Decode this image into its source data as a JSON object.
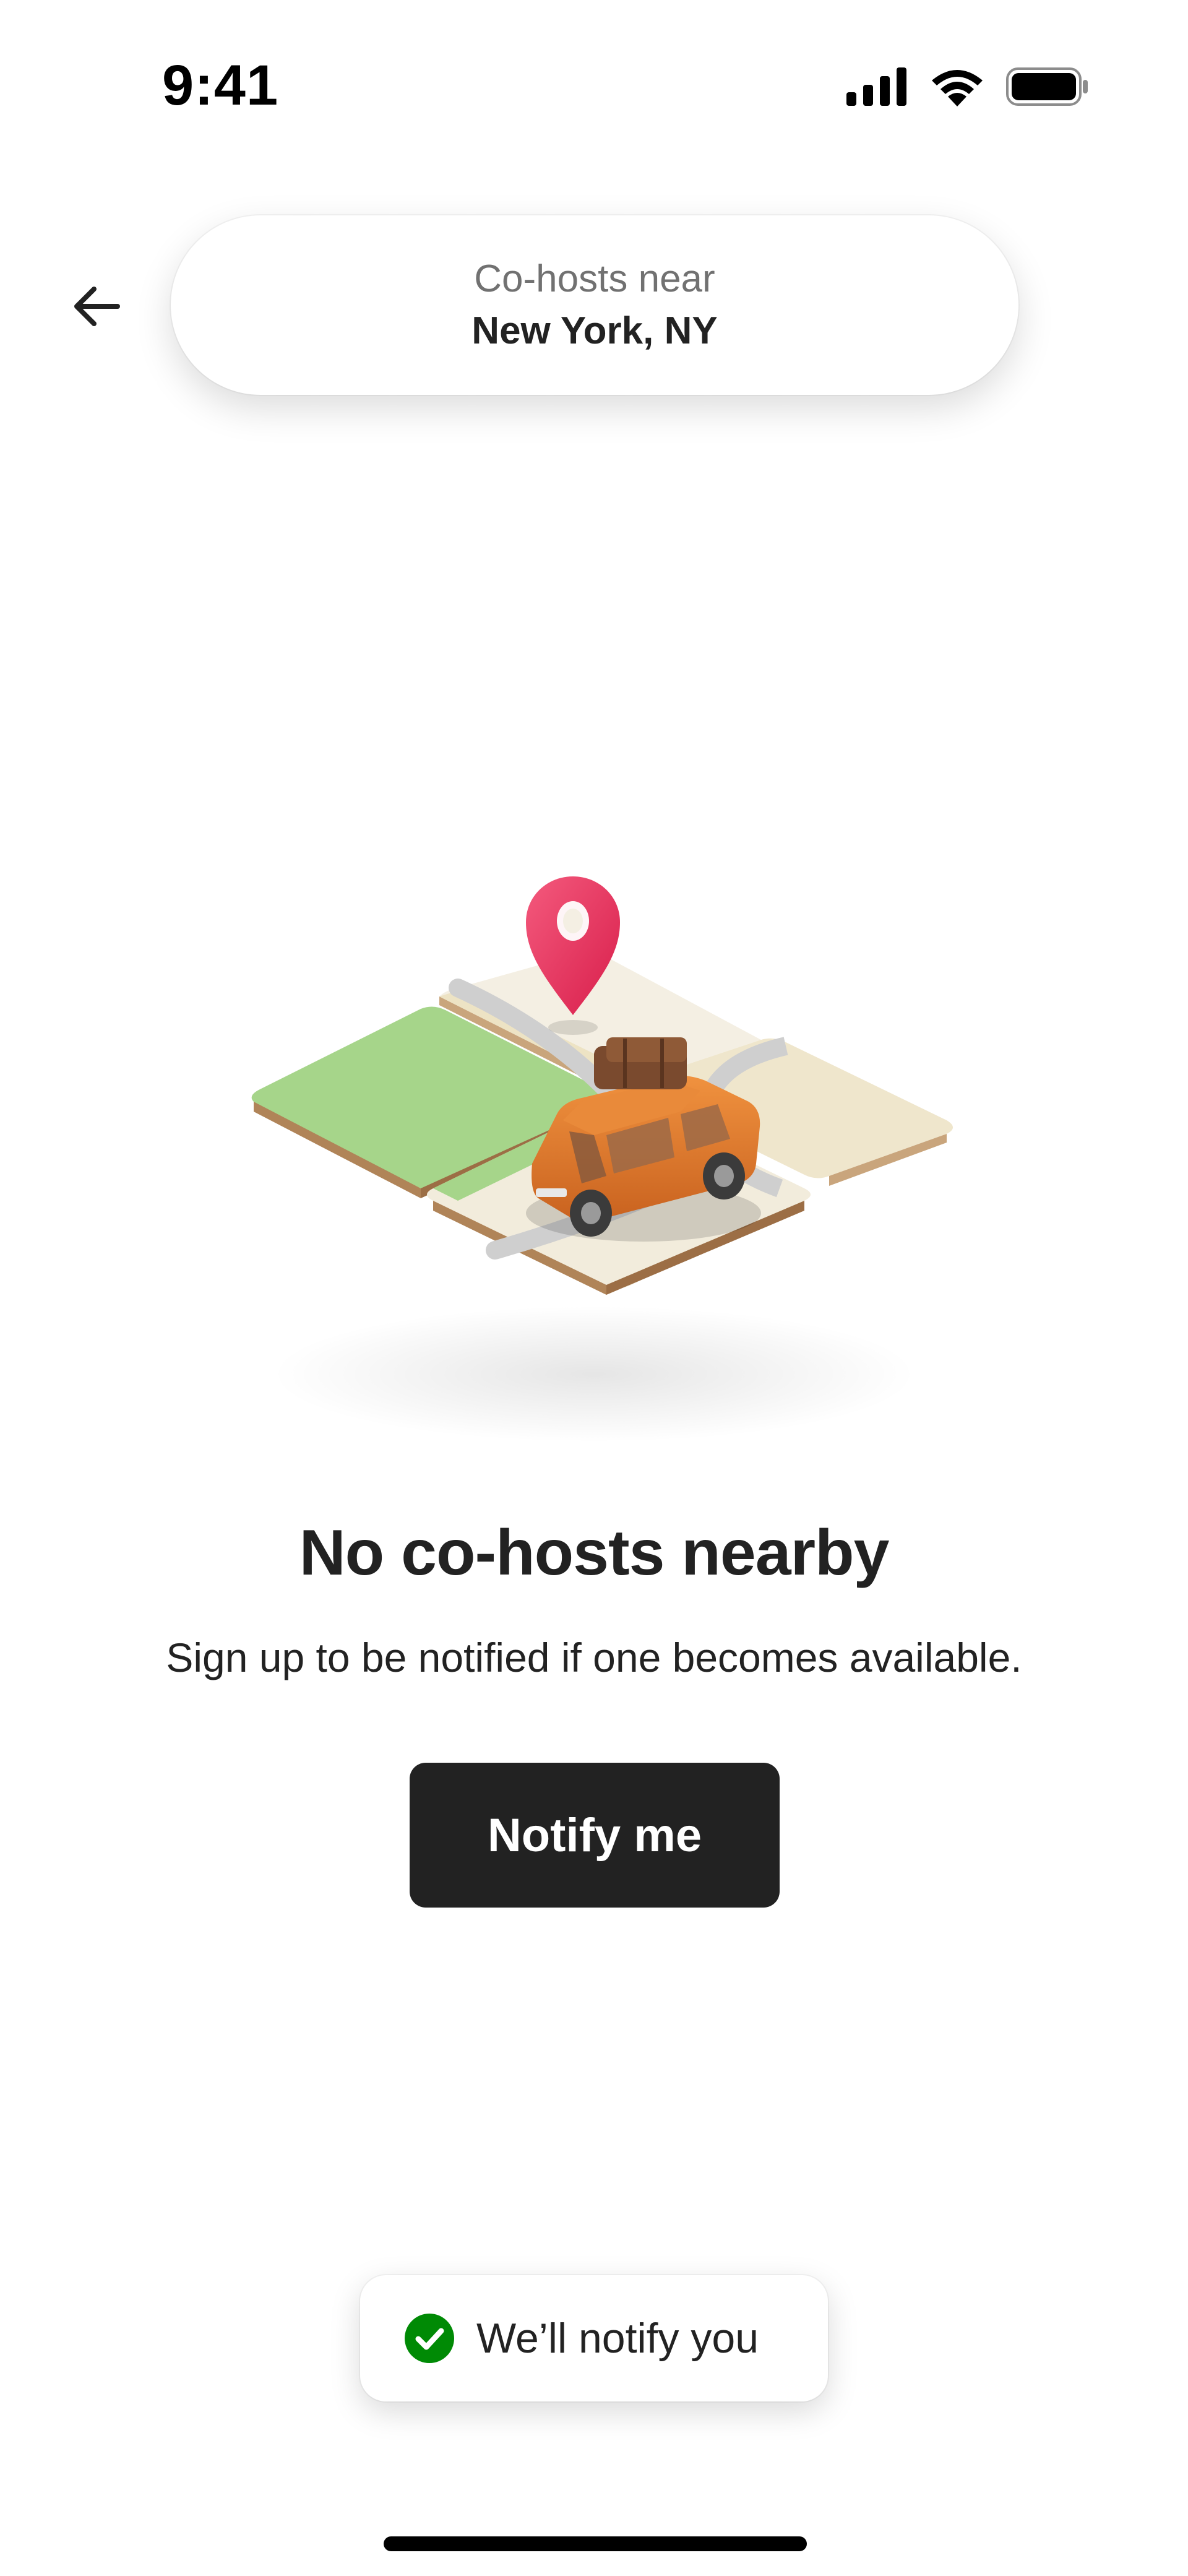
{
  "status_bar": {
    "time": "9:41",
    "icons": [
      "signal-icon",
      "wifi-icon",
      "battery-icon"
    ]
  },
  "header": {
    "back_icon": "arrow-left-icon",
    "location_label": "Co-hosts near",
    "location_value": "New York, NY"
  },
  "illustration": {
    "icon": "map-pin-car-illustration"
  },
  "empty_state": {
    "title": "No co-hosts nearby",
    "description": "Sign up to be notified if one becomes available.",
    "button_label": "Notify me"
  },
  "toast": {
    "icon": "check-circle-icon",
    "message": "We’ll notify you"
  },
  "colors": {
    "text": "#222222",
    "muted": "#717171",
    "button": "#222222",
    "success": "#008A05",
    "pin": "#E8315B",
    "car": "#E07A2E",
    "grass": "#A6D58A",
    "road": "#C7C7C7",
    "tile": "#EFE6D2"
  }
}
